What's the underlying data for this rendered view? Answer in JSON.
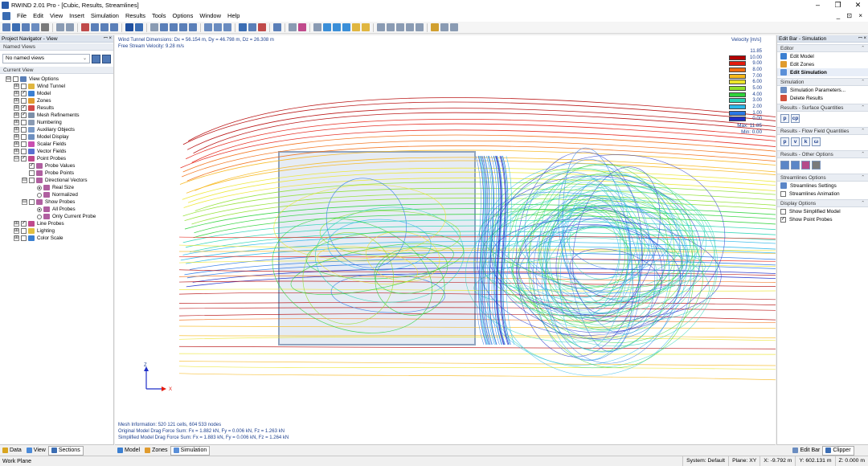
{
  "window": {
    "title": "RWIND 2.01 Pro - [Cubic, Results, Streamlines]",
    "min": "–",
    "max": "❐",
    "close": "✕"
  },
  "menu": {
    "items": [
      "File",
      "Edit",
      "View",
      "Insert",
      "Simulation",
      "Results",
      "Tools",
      "Options",
      "Window",
      "Help"
    ],
    "right": "_ ⊡ ×"
  },
  "navigator": {
    "title": "Project Navigator - View",
    "named_views_header": "Named Views",
    "named_views_value": "No named views",
    "current_view_header": "Current View",
    "tree": [
      {
        "label": "View Options",
        "level": 0,
        "exp": "⊟",
        "cb": "",
        "icon": "#5a7fb8"
      },
      {
        "label": "Wind Tunnel",
        "level": 1,
        "exp": "⊞",
        "cb": "",
        "icon": "#e0b640"
      },
      {
        "label": "Model",
        "level": 1,
        "exp": "⊞",
        "cb": "✓",
        "icon": "#3b7fd1"
      },
      {
        "label": "Zones",
        "level": 1,
        "exp": "⊞",
        "cb": "",
        "icon": "#e09b2e"
      },
      {
        "label": "Results",
        "level": 1,
        "exp": "⊞",
        "cb": "✓",
        "icon": "#d14a4a"
      },
      {
        "label": "Mesh Refinements",
        "level": 1,
        "exp": "⊞",
        "cb": "✓",
        "icon": "#7c8fa8"
      },
      {
        "label": "Numbering",
        "level": 1,
        "exp": "⊞",
        "cb": "",
        "icon": "#8a9bb3"
      },
      {
        "label": "Auxiliary Objects",
        "level": 1,
        "exp": "⊞",
        "cb": "",
        "icon": "#7b9bc7"
      },
      {
        "label": "Model Display",
        "level": 1,
        "exp": "⊞",
        "cb": "",
        "icon": "#6e8fbf"
      },
      {
        "label": "Scalar Fields",
        "level": 1,
        "exp": "⊞",
        "cb": "",
        "icon": "#c94fb0"
      },
      {
        "label": "Vector Fields",
        "level": 1,
        "exp": "⊞",
        "cb": "",
        "icon": "#5a6fd0"
      },
      {
        "label": "Point Probes",
        "level": 1,
        "exp": "⊟",
        "cb": "✓",
        "icon": "#c04a8c"
      },
      {
        "label": "Probe Values",
        "level": 2,
        "exp": "",
        "cb": "✓",
        "icon": "#b05fa0"
      },
      {
        "label": "Probe Points",
        "level": 2,
        "exp": "",
        "cb": "",
        "icon": "#b05fa0"
      },
      {
        "label": "Directional Vectors",
        "level": 2,
        "exp": "⊟",
        "cb": "",
        "icon": "#b05fa0"
      },
      {
        "label": "Real Size",
        "level": 3,
        "exp": "",
        "rad": "on",
        "icon": "#b05fa0"
      },
      {
        "label": "Normalized",
        "level": 3,
        "exp": "",
        "rad": "off",
        "icon": "#b05fa0"
      },
      {
        "label": "Show Probes",
        "level": 2,
        "exp": "⊟",
        "cb": "",
        "icon": "#b05fa0"
      },
      {
        "label": "All Probes",
        "level": 3,
        "exp": "",
        "rad": "on",
        "icon": "#b05fa0"
      },
      {
        "label": "Only Current Probe",
        "level": 3,
        "exp": "",
        "rad": "off",
        "icon": "#b05fa0"
      },
      {
        "label": "Line Probes",
        "level": 1,
        "exp": "⊞",
        "cb": "✓",
        "icon": "#c04a8c"
      },
      {
        "label": "Lighting",
        "level": 1,
        "exp": "⊞",
        "cb": "",
        "icon": "#e0c040"
      },
      {
        "label": "Color Scale",
        "level": 1,
        "exp": "⊞",
        "cb": "",
        "icon": "#3a7fd0"
      }
    ],
    "tabs": [
      "Data",
      "View",
      "Sections"
    ]
  },
  "viewport": {
    "dims": "Wind Tunnel Dimensions: Dx = 56.154 m, Dy = 46.798 m, Dz = 26.308 m",
    "velocity": "Free Stream Velocity: 9.28 m/s",
    "legend_title": "Velocity [m/s]",
    "legend": [
      {
        "v": "11.85",
        "c": ""
      },
      {
        "v": "10.00",
        "c": "#b40000"
      },
      {
        "v": "9.00",
        "c": "#e41b0e"
      },
      {
        "v": "8.00",
        "c": "#f26b10"
      },
      {
        "v": "7.00",
        "c": "#f7b71a"
      },
      {
        "v": "6.00",
        "c": "#ece52a"
      },
      {
        "v": "5.00",
        "c": "#8fe02c"
      },
      {
        "v": "4.00",
        "c": "#2ed33a"
      },
      {
        "v": "3.00",
        "c": "#2ad4b4"
      },
      {
        "v": "2.00",
        "c": "#2cb8ea"
      },
      {
        "v": "1.00",
        "c": "#2a78e6"
      },
      {
        "v": "0.00",
        "c": "#1f2fc8"
      }
    ],
    "max_label": "Max:",
    "max_value": "11.85",
    "min_label": "Min:",
    "min_value": "0.00",
    "mesh_info": "Mesh Information: 520 121 cells, 604 533 nodes",
    "orig_drag": "Original Model Drag Force Sum: Fx = 1.882 kN, Fy = 0.006 kN, Fz = 1.263 kN",
    "simp_drag": "Simplified Model Drag Force Sum: Fx = 1.883 kN, Fy = 0.006 kN, Fz = 1.264 kN",
    "axis_z": "Z",
    "axis_x": "X",
    "tabs": [
      "Model",
      "Zones",
      "Simulation"
    ]
  },
  "editbar": {
    "title": "Edit Bar - Simulation",
    "editor_header": "Editor",
    "editor_items": [
      "Edit Model",
      "Edit Zones",
      "Edit Simulation"
    ],
    "simulation_header": "Simulation",
    "simulation_items": [
      "Simulation Parameters...",
      "Delete Results"
    ],
    "surface_header": "Results - Surface Quantities",
    "surface_btns": [
      "p",
      "cp"
    ],
    "flow_header": "Results - Flow Field Quantities",
    "flow_btns": [
      "p",
      "v",
      "k",
      "ω"
    ],
    "other_header": "Results - Other Options",
    "streamlines_header": "Streamlines Options",
    "streamlines_items": [
      {
        "label": "Streamlines Settings",
        "cb": null
      },
      {
        "label": "Streamlines Animation",
        "cb": ""
      }
    ],
    "display_header": "Display Options",
    "display_items": [
      {
        "label": "Show Simplified Model",
        "cb": ""
      },
      {
        "label": "Show Point Probes",
        "cb": "✓"
      }
    ],
    "tabs": [
      "Edit Bar",
      "Clipper"
    ]
  },
  "status": {
    "left": "Work Plane",
    "system": "System: Default",
    "plane": "Plane: XY",
    "x": "X: -9.792 m",
    "y": "Y: 602.131 m",
    "z": "Z: 0.000 m"
  }
}
